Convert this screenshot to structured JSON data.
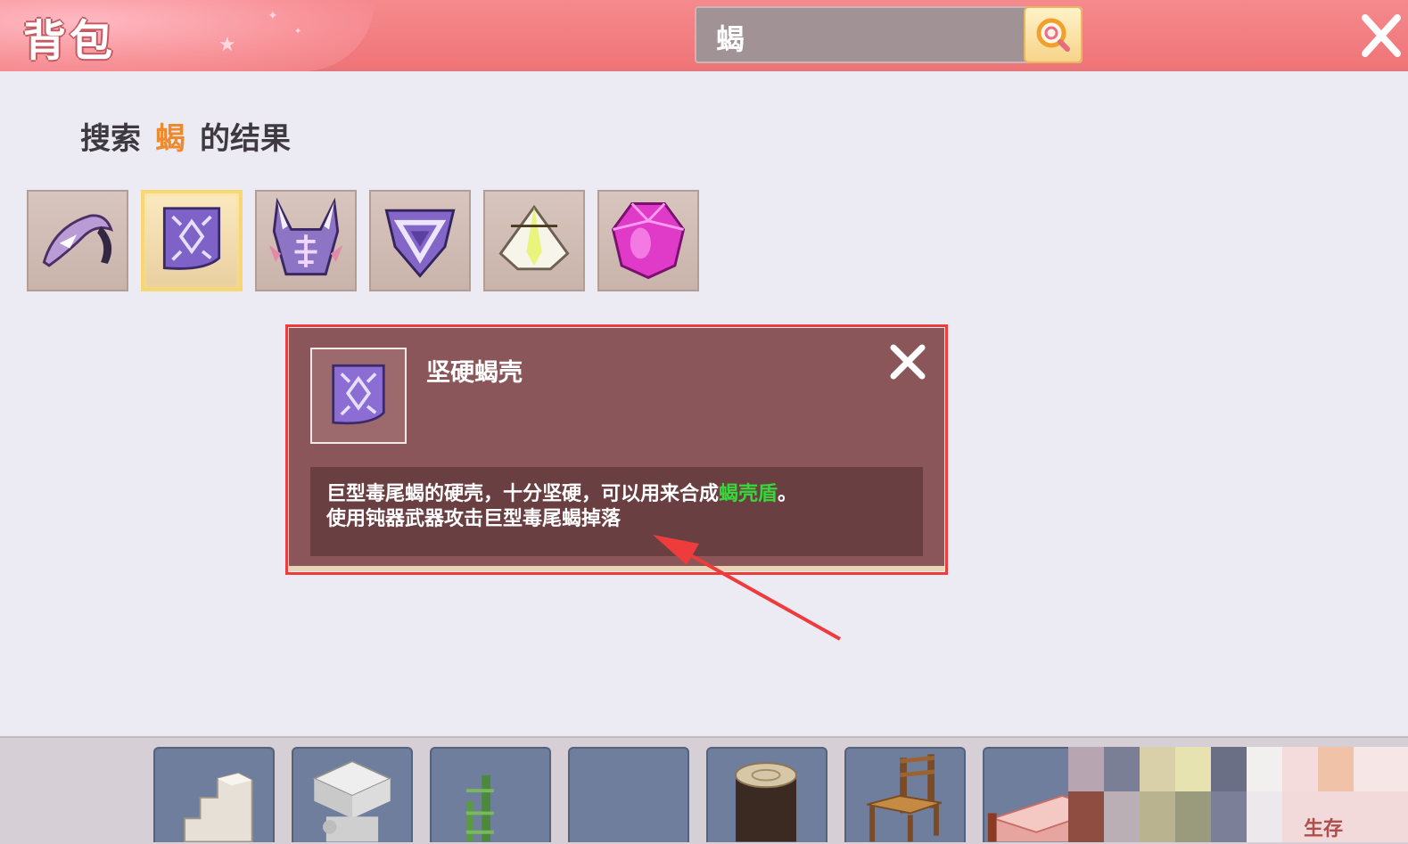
{
  "header": {
    "title": "背包",
    "search_value": "蝎",
    "search_icon": "magnifier-icon",
    "close_icon": "close-icon"
  },
  "results": {
    "prefix": "搜索",
    "keyword": "蝎",
    "suffix": "的结果",
    "items": [
      {
        "icon": "scorpion-helmet-icon"
      },
      {
        "icon": "scorpion-shell-icon",
        "selected": true
      },
      {
        "icon": "scorpion-armor-icon"
      },
      {
        "icon": "scorpion-shield-icon"
      },
      {
        "icon": "white-crystal-icon"
      },
      {
        "icon": "pink-gem-icon"
      }
    ]
  },
  "tooltip": {
    "item_name": "坚硬蝎壳",
    "desc_part1": "巨型毒尾蝎的硬壳，十分坚硬，可以用来合成",
    "desc_link": "蝎壳盾",
    "desc_part2": "。",
    "desc_line2": "使用钝器武器攻击巨型毒尾蝎掉落"
  },
  "hotbar": {
    "items": [
      "stairs-icon",
      "stone-pillar-icon",
      "bamboo-icon",
      "empty-slot",
      "log-icon",
      "chair-icon",
      "bed-icon"
    ],
    "survival_label": "生存"
  },
  "colors": {
    "header": "#ef7478",
    "tooltip_bg": "#8a5659",
    "highlight": "#ee3b3b",
    "keyword": "#ee8a2d",
    "link_green": "#38d63a"
  }
}
